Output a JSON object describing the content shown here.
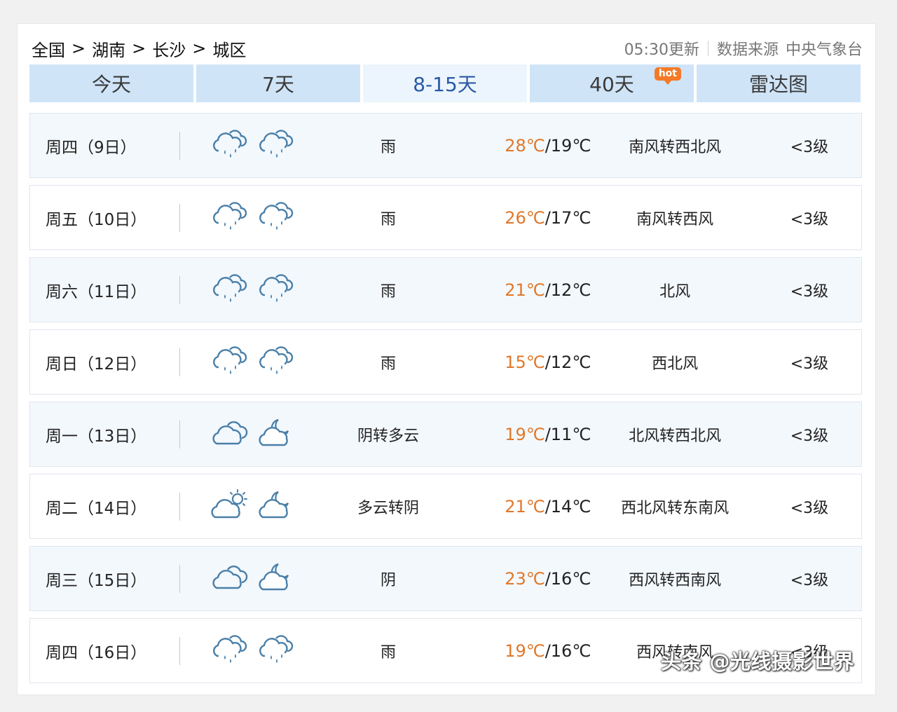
{
  "breadcrumb": [
    "全国",
    "湖南",
    "长沙",
    "城区"
  ],
  "breadcrumb_sep": ">",
  "update_time": "05:30更新",
  "source_label": "数据来源",
  "source_name": "中央气象台",
  "tabs": [
    {
      "label": "今天"
    },
    {
      "label": "7天"
    },
    {
      "label": "8-15天",
      "active": true
    },
    {
      "label": "40天",
      "badge": "hot"
    },
    {
      "label": "雷达图"
    }
  ],
  "forecast": [
    {
      "date": "周四（9日）",
      "icons": [
        "rain-icon",
        "rain-icon"
      ],
      "weather": "雨",
      "high": "28℃",
      "low": "19℃",
      "wind": "南风转西北风",
      "level": "<3级"
    },
    {
      "date": "周五（10日）",
      "icons": [
        "rain-icon",
        "rain-icon"
      ],
      "weather": "雨",
      "high": "26℃",
      "low": "17℃",
      "wind": "南风转西风",
      "level": "<3级"
    },
    {
      "date": "周六（11日）",
      "icons": [
        "rain-icon",
        "rain-icon"
      ],
      "weather": "雨",
      "high": "21℃",
      "low": "12℃",
      "wind": "北风",
      "level": "<3级"
    },
    {
      "date": "周日（12日）",
      "icons": [
        "rain-icon",
        "rain-icon"
      ],
      "weather": "雨",
      "high": "15℃",
      "low": "12℃",
      "wind": "西北风",
      "level": "<3级"
    },
    {
      "date": "周一（13日）",
      "icons": [
        "overcast-icon",
        "cloudy-night-icon"
      ],
      "weather": "阴转多云",
      "high": "19℃",
      "low": "11℃",
      "wind": "北风转西北风",
      "level": "<3级"
    },
    {
      "date": "周二（14日）",
      "icons": [
        "partly-cloudy-day-icon",
        "cloudy-night-icon"
      ],
      "weather": "多云转阴",
      "high": "21℃",
      "low": "14℃",
      "wind": "西北风转东南风",
      "level": "<3级"
    },
    {
      "date": "周三（15日）",
      "icons": [
        "overcast-icon",
        "cloudy-night-icon"
      ],
      "weather": "阴",
      "high": "23℃",
      "low": "16℃",
      "wind": "西风转西南风",
      "level": "<3级"
    },
    {
      "date": "周四（16日）",
      "icons": [
        "rain-icon",
        "rain-icon"
      ],
      "weather": "雨",
      "high": "19℃",
      "low": "16℃",
      "wind": "西风转南风",
      "level": "<3级"
    }
  ],
  "watermark": "头条 @光线摄影世界",
  "colors": {
    "accent": "#2a5aa5",
    "high_temp": "#e0782a",
    "icon": "#4a7fa8",
    "tab_bg": "#cfe4f7",
    "tab_active_bg": "#ecf5fd"
  }
}
